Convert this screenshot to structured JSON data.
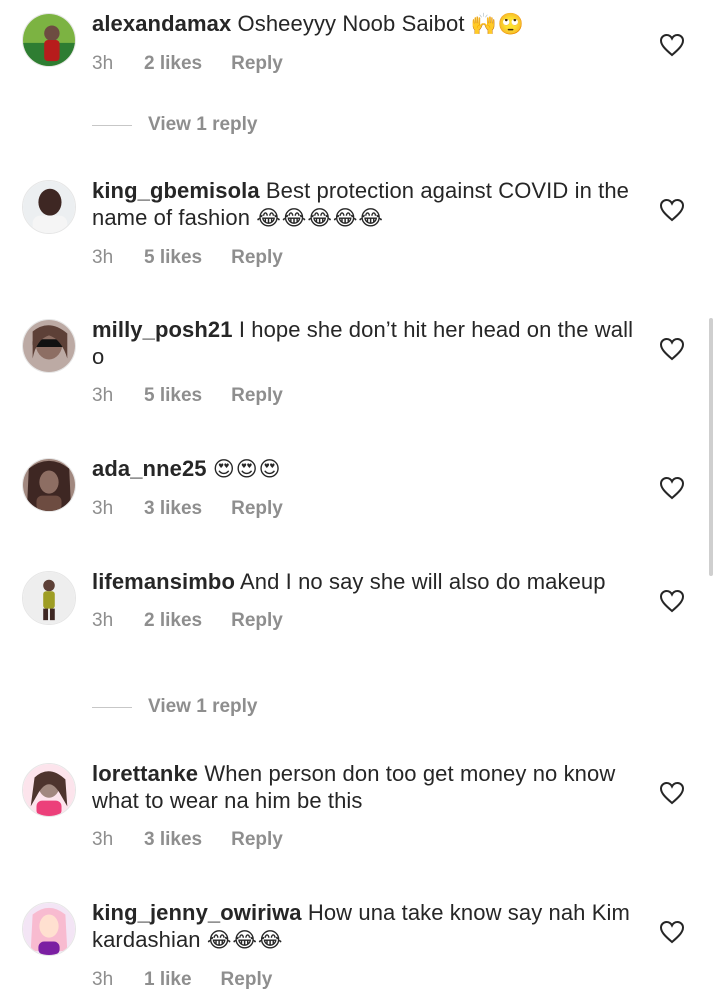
{
  "comments": [
    {
      "username": "alexandamax",
      "text": "Osheeyyy Noob Saibot",
      "emoji": "🙌🙄",
      "time": "3h",
      "likes": "2 likes",
      "reply": "Reply",
      "avatar_colors": [
        "#2e7d32",
        "#6d4c41"
      ]
    },
    {
      "username": "king_gbemisola",
      "text": "Best protection against COVID in the name of fashion",
      "emoji": "😂😂😂😂😂",
      "time": "3h",
      "likes": "5 likes",
      "reply": "Reply",
      "avatar_colors": [
        "#d7ccc8",
        "#3e2723"
      ]
    },
    {
      "username": "milly_posh21",
      "text": "I hope she don’t hit her head on the wall o",
      "emoji": "",
      "time": "3h",
      "likes": "5 likes",
      "reply": "Reply",
      "avatar_colors": [
        "#c8b8a8",
        "#1b1b1b"
      ]
    },
    {
      "username": "ada_nne25",
      "text": "",
      "emoji": "😍😍😍",
      "time": "3h",
      "likes": "3 likes",
      "reply": "Reply",
      "avatar_colors": [
        "#5d4037",
        "#8d6e63"
      ]
    },
    {
      "username": "lifemansimbo",
      "text": "And I no say she will also do makeup",
      "emoji": "",
      "time": "3h",
      "likes": "2 likes",
      "reply": "Reply",
      "avatar_colors": [
        "#e0e0e0",
        "#9e9d24"
      ]
    },
    {
      "username": "lorettanke",
      "text": "When person don too get money no know what to wear na him be this",
      "emoji": "",
      "time": "3h",
      "likes": "3 likes",
      "reply": "Reply",
      "avatar_colors": [
        "#f8bbd0",
        "#4e342e"
      ]
    },
    {
      "username": "king_jenny_owiriwa",
      "text": "How una take know say nah Kim kardashian",
      "emoji": "😂😂😂",
      "time": "3h",
      "likes": "1 like",
      "reply": "Reply",
      "avatar_colors": [
        "#e1bee7",
        "#6a1b9a"
      ]
    }
  ],
  "view_replies": [
    {
      "label": "View 1 reply"
    },
    {
      "label": "View 1 reply"
    }
  ],
  "icons": {
    "like": "heart-outline-icon"
  },
  "colors": {
    "text": "#262626",
    "muted": "#8e8e8e",
    "background": "#ffffff"
  }
}
